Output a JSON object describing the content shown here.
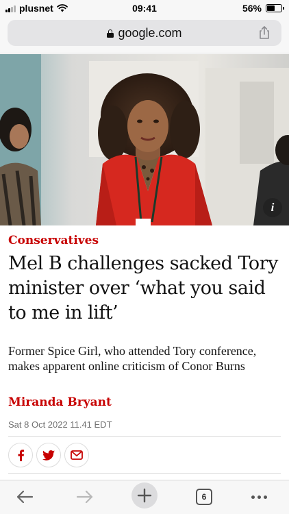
{
  "status_bar": {
    "carrier": "plusnet",
    "time": "09:41",
    "battery_percent": "56%",
    "battery_level": 0.56
  },
  "browser": {
    "url": "google.com",
    "open_tabs_count": "6"
  },
  "article": {
    "section": "Conservatives",
    "headline": "Mel B challenges sacked Tory minister over ‘what you said to me in lift’",
    "standfirst": "Former Spice Girl, who attended Tory conference, makes apparent online criticism of Conor Burns",
    "author": "Miranda Bryant",
    "published": "Sat 8 Oct 2022 11.41 EDT",
    "image_info_label": "i"
  },
  "share_icons": [
    "facebook-icon",
    "twitter-icon",
    "email-icon"
  ],
  "toolbar_icons": [
    "back-arrow-icon",
    "forward-arrow-icon",
    "new-tab-plus-icon",
    "tabs-icon",
    "more-icon"
  ],
  "colors": {
    "accent_red": "#c70000",
    "chrome_bg": "#f7f7f7",
    "url_pill": "#e4e4e6"
  }
}
